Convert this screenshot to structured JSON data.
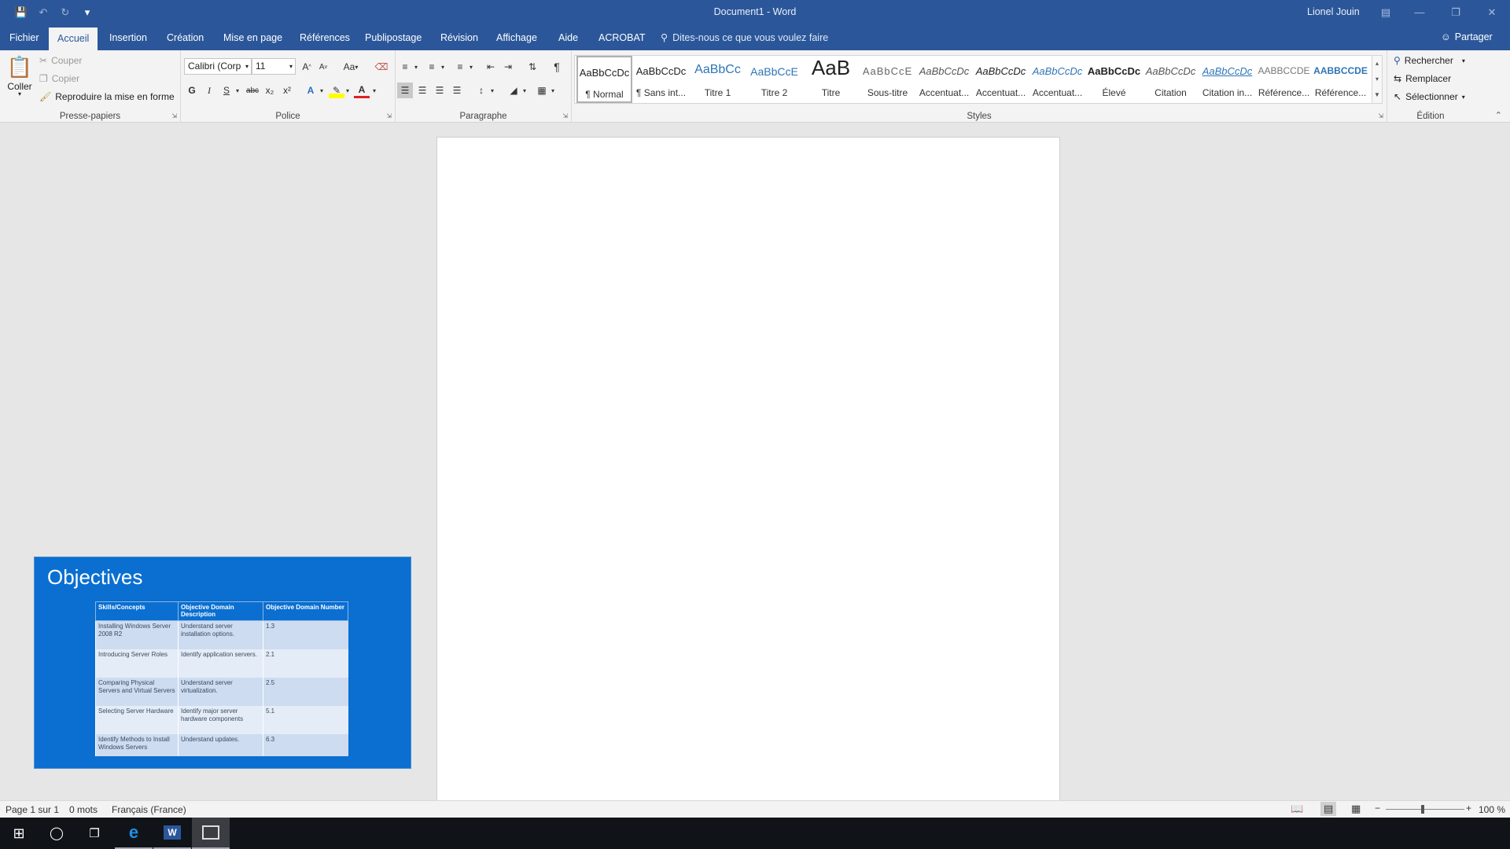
{
  "titlebar": {
    "doc_title": "Document1  -  Word",
    "user": "Lionel Jouin"
  },
  "tabs": [
    "Fichier",
    "Accueil",
    "Insertion",
    "Création",
    "Mise en page",
    "Références",
    "Publipostage",
    "Révision",
    "Affichage",
    "Aide",
    "ACROBAT"
  ],
  "active_tab": "Accueil",
  "tellme": "Dites-nous ce que vous voulez faire",
  "share": "Partager",
  "clipboard": {
    "paste": "Coller",
    "cut": "Couper",
    "copy": "Copier",
    "format_painter": "Reproduire la mise en forme",
    "label": "Presse-papiers"
  },
  "font": {
    "name": "Calibri (Corp",
    "size": "11",
    "case": "Aa",
    "bold": "G",
    "italic": "I",
    "underline": "S",
    "strike": "abc",
    "sub": "x₂",
    "sup": "x²",
    "label": "Police"
  },
  "paragraph": {
    "label": "Paragraphe"
  },
  "styles": {
    "label": "Styles",
    "items": [
      {
        "preview": "AaBbCcDc",
        "label": "¶ Normal"
      },
      {
        "preview": "AaBbCcDc",
        "label": "¶ Sans int..."
      },
      {
        "preview": "AaBbCc",
        "label": "Titre 1"
      },
      {
        "preview": "AaBbCcE",
        "label": "Titre 2"
      },
      {
        "preview": "AaB",
        "label": "Titre"
      },
      {
        "preview": "AaBbCcE",
        "label": "Sous-titre"
      },
      {
        "preview": "AaBbCcDc",
        "label": "Accentuat..."
      },
      {
        "preview": "AaBbCcDc",
        "label": "Accentuat..."
      },
      {
        "preview": "AaBbCcDc",
        "label": "Accentuat..."
      },
      {
        "preview": "AaBbCcDc",
        "label": "Élevé"
      },
      {
        "preview": "AaBbCcDc",
        "label": "Citation"
      },
      {
        "preview": "AaBbCcDc",
        "label": "Citation in..."
      },
      {
        "preview": "AABBCCDE",
        "label": "Référence..."
      },
      {
        "preview": "AABBCCDE",
        "label": "Référence..."
      }
    ]
  },
  "editing": {
    "find": "Rechercher",
    "replace": "Remplacer",
    "select": "Sélectionner",
    "label": "Édition"
  },
  "slide": {
    "title": "Objectives",
    "headers": [
      "Skills/Concepts",
      "Objective Domain Description",
      "Objective Domain Number"
    ],
    "rows": [
      [
        "Installing Windows Server 2008 R2",
        "Understand server installation options.",
        "1.3"
      ],
      [
        "Introducing Server Roles",
        "Identify application servers.",
        "2.1"
      ],
      [
        "Comparing Physical Servers and Virtual Servers",
        "Understand server virtualization.",
        "2.5"
      ],
      [
        "Selecting Server Hardware",
        "Identify major server hardware components",
        "5.1"
      ],
      [
        "Identify Methods to Install Windows Servers",
        "Understand updates.",
        "6.3"
      ]
    ]
  },
  "status": {
    "page": "Page 1 sur 1",
    "words": "0 mots",
    "language": "Français (France)",
    "zoom": "100 %"
  },
  "colors": {
    "accent": "#2b579a",
    "slide_bg": "#0a6fd1"
  }
}
